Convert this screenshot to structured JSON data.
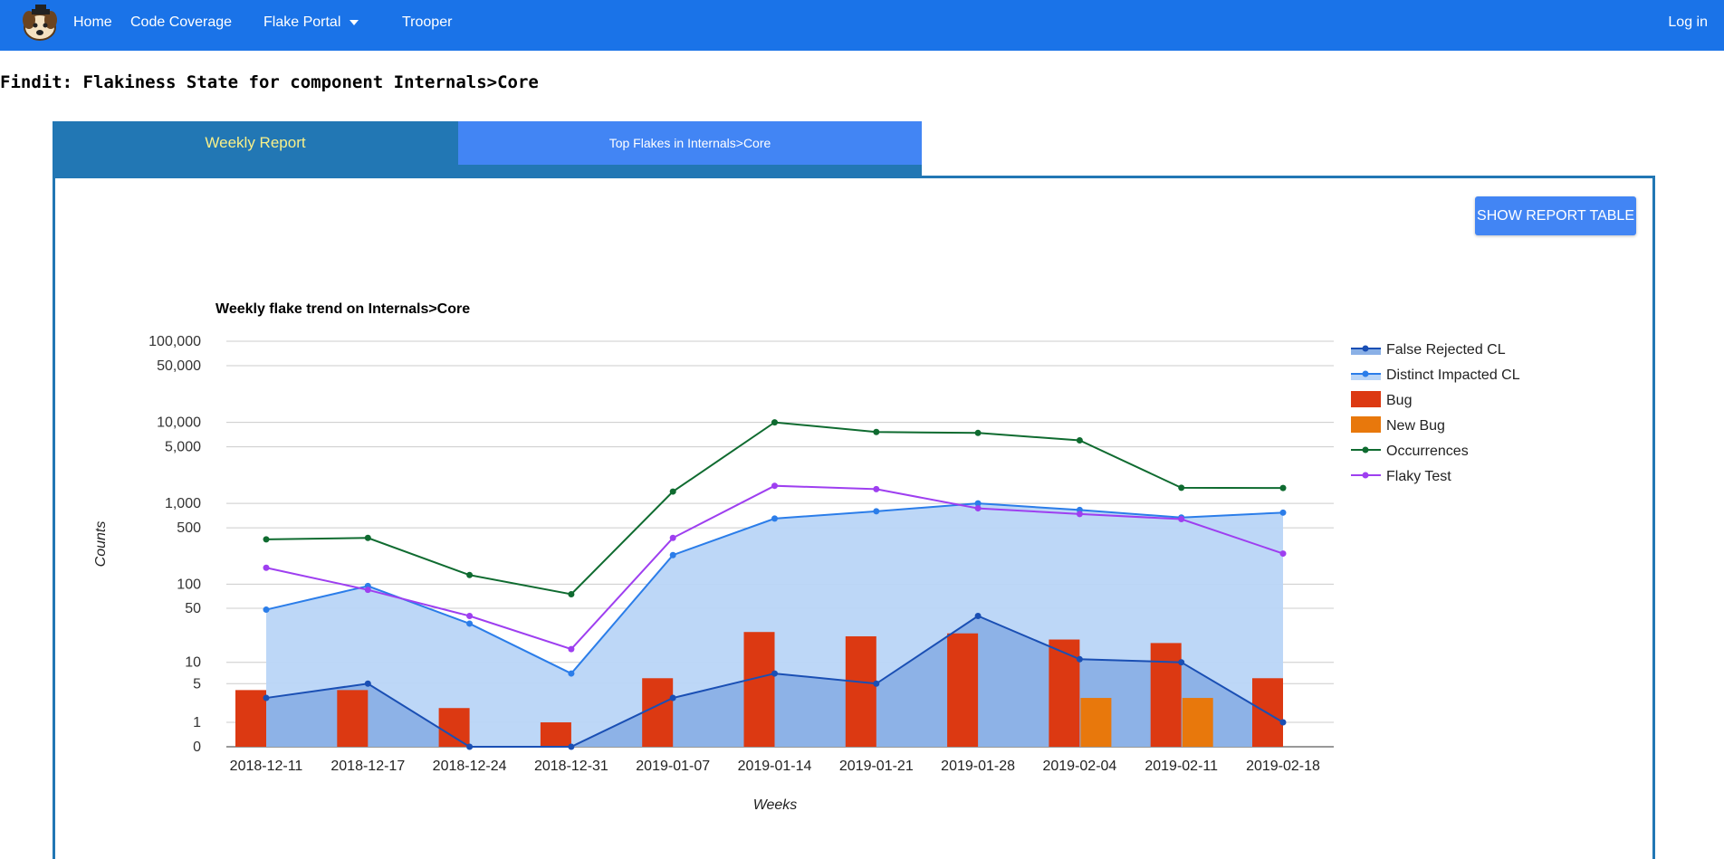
{
  "nav": {
    "home": "Home",
    "coverage": "Code Coverage",
    "flake_portal": "Flake Portal",
    "trooper": "Trooper",
    "login": "Log in"
  },
  "page_title": "Findit: Flakiness State for component Internals>Core",
  "tabs": {
    "weekly": "Weekly Report",
    "top": "Top Flakes in Internals>Core"
  },
  "show_report_label": "SHOW REPORT TABLE",
  "colors": {
    "brand": "#1a73e8",
    "tab_bar": "#2277b4",
    "tab_active_text": "#f8f08a",
    "tab_inactive": "#4285f4"
  },
  "chart_data": {
    "type": "combo",
    "title": "Weekly flake trend on Internals>Core",
    "xlabel": "Weeks",
    "ylabel": "Counts",
    "yscale": "log",
    "y_ticks": [
      0,
      1,
      5,
      10,
      50,
      100,
      500,
      1000,
      5000,
      10000,
      50000,
      100000
    ],
    "y_tick_labels": [
      "0",
      "1",
      "5",
      "10",
      "50",
      "100",
      "500",
      "1,000",
      "5,000",
      "10,000",
      "50,000",
      "100,000"
    ],
    "grid": true,
    "legend_position": "right",
    "categories": [
      "2018-12-11",
      "2018-12-17",
      "2018-12-24",
      "2018-12-31",
      "2019-01-07",
      "2019-01-14",
      "2019-01-21",
      "2019-01-28",
      "2019-02-04",
      "2019-02-11",
      "2019-02-18"
    ],
    "series": [
      {
        "name": "False Rejected CL",
        "kind": "area",
        "color": "#1a4fb4",
        "fill": "#8ab0e6",
        "values": [
          3,
          5,
          0,
          0,
          3,
          7,
          5,
          40,
          11,
          10,
          1
        ]
      },
      {
        "name": "Distinct Impacted CL",
        "kind": "area",
        "color": "#2b7de9",
        "fill": "#b9d5f7",
        "values": [
          48,
          95,
          32,
          7,
          230,
          650,
          800,
          1000,
          830,
          670,
          770
        ]
      },
      {
        "name": "Bug",
        "kind": "bar",
        "color": "#dc3912",
        "values": [
          4,
          4,
          2,
          1,
          6,
          25,
          22,
          24,
          20,
          18,
          6
        ]
      },
      {
        "name": "New Bug",
        "kind": "bar",
        "color": "#e8780c",
        "values": [
          0,
          0,
          0,
          0,
          0,
          0,
          0,
          0,
          3,
          3,
          0
        ]
      },
      {
        "name": "Occurrences",
        "kind": "line",
        "color": "#0f6b30",
        "values": [
          360,
          375,
          130,
          75,
          1400,
          10000,
          7600,
          7400,
          6000,
          1560,
          1550
        ]
      },
      {
        "name": "Flaky Test",
        "kind": "line",
        "color": "#9e3ff0",
        "values": [
          160,
          85,
          40,
          15,
          375,
          1650,
          1500,
          870,
          740,
          640,
          240
        ]
      }
    ]
  }
}
